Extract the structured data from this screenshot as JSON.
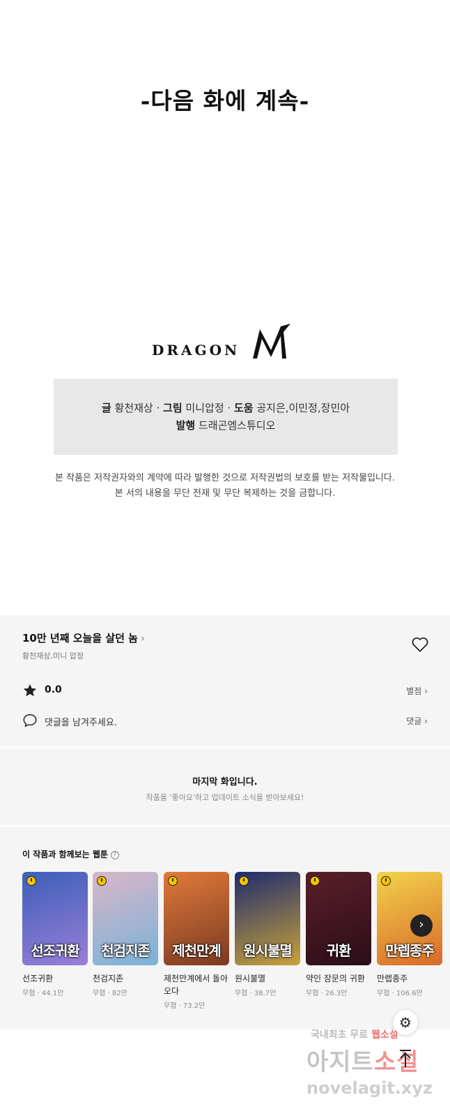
{
  "comic": {
    "next_caption": "-다음 화에 계속-",
    "logo_text": "DRAGON",
    "credits_line1": [
      {
        "label": "글",
        "value": "황천재상"
      },
      {
        "label": "그림",
        "value": "미니압정"
      },
      {
        "label": "도움",
        "value": "공지은,이민정,장민아"
      }
    ],
    "credits_line2": {
      "label": "발행",
      "value": "드래곤엠스튜디오"
    },
    "copyright_line1": "본 작품은 저작권자와의 계약에 따라 발행한 것으로 저작권법의 보호를 받는 저작물입니다.",
    "copyright_line2": "본 서의 내용을 무단 전재 및 무단 복제하는 것을 금합니다."
  },
  "info": {
    "title": "10만 년째 오늘을 살던 놈",
    "author": "황천재상,미니 압정",
    "rating_value": "0.0",
    "rating_link": "별점",
    "comment_placeholder": "댓글을 남겨주세요.",
    "comment_link": "댓글"
  },
  "last_episode": {
    "title": "마지막 화입니다.",
    "subtitle": "작품을 '좋아요'하고 업데이트 소식을 받아보세요!"
  },
  "recommendations": {
    "header": "이 작품과 함께보는 웹툰",
    "items": [
      {
        "name": "선조귀환",
        "meta": "무협 · 44.1만",
        "cover_text": "선조귀환",
        "color1": "#3c5fb8",
        "color2": "#9a7fd8"
      },
      {
        "name": "천검지존",
        "meta": "무협 · 82만",
        "cover_text": "천검지존",
        "color1": "#d9b6c8",
        "color2": "#7ab2d8"
      },
      {
        "name": "제천만계에서 돌아오다",
        "meta": "무협 · 73.2만",
        "cover_text": "제천만계",
        "color1": "#e07a3a",
        "color2": "#7a3a22"
      },
      {
        "name": "원시불멸",
        "meta": "무협 · 38.7만",
        "cover_text": "원시불멸",
        "color1": "#1d2b6e",
        "color2": "#c9a23a"
      },
      {
        "name": "약인 장문의 귀환",
        "meta": "무협 · 26.3만",
        "cover_text": "귀환",
        "color1": "#5a1e2a",
        "color2": "#2a0e18"
      },
      {
        "name": "만렙종주",
        "meta": "무협 · 106.6만",
        "cover_text": "만렙종주",
        "color1": "#f2d34a",
        "color2": "#d86a2a"
      }
    ]
  },
  "watermark": {
    "line1a": "국내최초 무료",
    "line1b": "웹소설",
    "line2a": "아지트",
    "line2b": "소설",
    "line3": "novelagit.xyz"
  }
}
